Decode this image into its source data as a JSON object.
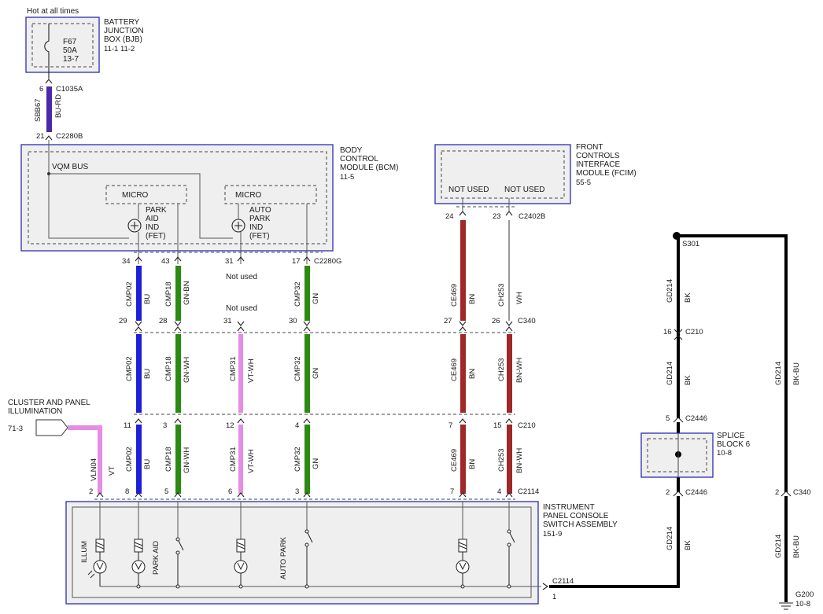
{
  "top_label": "Hot at all times",
  "bjb": {
    "name": [
      "BATTERY",
      "JUNCTION",
      "BOX (BJB)"
    ],
    "ref": "11-1    11-2",
    "fuse": [
      "F67",
      "50A",
      "13-7"
    ]
  },
  "bcm": {
    "name": [
      "BODY",
      "CONTROL",
      "MODULE (BCM)"
    ],
    "ref": "11-5",
    "bus": "VQM BUS",
    "micro": "MICRO",
    "park_ind": [
      "PARK",
      "AID",
      "IND",
      "(FET)"
    ],
    "auto_ind": [
      "AUTO",
      "PARK",
      "IND",
      "(FET)"
    ]
  },
  "fcim": {
    "name": [
      "FRONT",
      "CONTROLS",
      "INTERFACE",
      "MODULE (FCIM)"
    ],
    "ref": "55-5",
    "not_used": "NOT USED"
  },
  "cluster": {
    "name": [
      "CLUSTER AND PANEL",
      "ILLUMINATION"
    ],
    "ref": "71-3"
  },
  "ipcs": {
    "name": [
      "INSTRUMENT",
      "PANEL CONSOLE",
      "SWITCH ASSEMBLY"
    ],
    "ref": "151-9",
    "illum": "ILLUM",
    "park_aid": "PARK AID",
    "auto_park": "AUTO PARK"
  },
  "splice": {
    "name": [
      "SPLICE",
      "BLOCK 6"
    ],
    "ref": "10-8"
  },
  "ground": {
    "name": "G200",
    "ref": "10-8"
  },
  "not_used": "Not used",
  "connectors": {
    "c1035a": "C1035A",
    "c2280b": "C2280B",
    "c2280g": "C2280G",
    "c2402b": "C2402B",
    "c340": "C340",
    "c210": "C210",
    "c2114": "C2114",
    "c2446": "C2446",
    "s301": "S301"
  },
  "wires": [
    {
      "circuit": "SBB67",
      "color": "BU-RD"
    },
    {
      "circuit": "CMP02",
      "color": "BU"
    },
    {
      "circuit": "CMP18",
      "color": "GN-BN"
    },
    {
      "circuit": "CMP18",
      "color": "GN-WH"
    },
    {
      "circuit": "CMP31",
      "color": "VT-WH"
    },
    {
      "circuit": "CMP32",
      "color": "GN"
    },
    {
      "circuit": "CE469",
      "color": "BN"
    },
    {
      "circuit": "CH253",
      "color": "WH"
    },
    {
      "circuit": "CH253",
      "color": "BN-WH"
    },
    {
      "circuit": "VLN04",
      "color": "VT"
    },
    {
      "circuit": "GD214",
      "color": "BK"
    },
    {
      "circuit": "GD214",
      "color": "BK-BU"
    }
  ],
  "pins": {
    "bjb": "6",
    "bcm_in": "21",
    "bcm_out": [
      "34",
      "43",
      "31",
      "17"
    ],
    "fcim_out": [
      "24",
      "23"
    ],
    "c340_upper": [
      "29",
      "28",
      "31",
      "30",
      "27",
      "26"
    ],
    "c210_lower": [
      "11",
      "3",
      "12",
      "4",
      "7",
      "15"
    ],
    "c2114": [
      "2",
      "8",
      "5",
      "6",
      "3",
      "7",
      "4"
    ],
    "c2114_out": "1",
    "c210_gd": "16",
    "c2446_top": "5",
    "c2446_bot": "2",
    "c340_gd": "2"
  },
  "colors": {
    "blue": "#1f1fd6",
    "green": "#2c8a12",
    "brown": "#a02828",
    "violet": "#e58ce5",
    "black": "#000000",
    "purple": "#4a2aa8",
    "frame": "#2b2bb3"
  }
}
